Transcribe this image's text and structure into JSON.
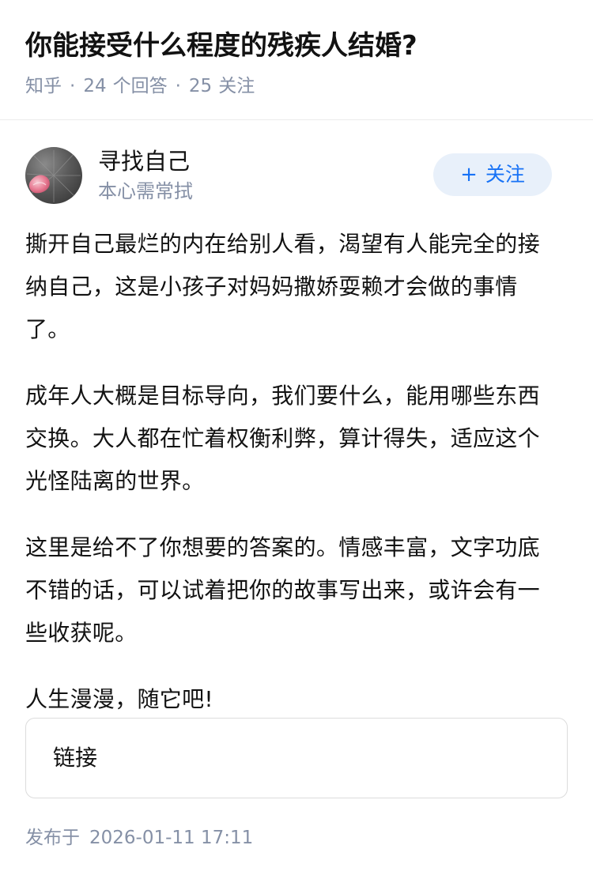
{
  "question": {
    "title": "你能接受什么程度的残疾人结婚?",
    "source": "知乎",
    "separator": "·",
    "answer_count": "24",
    "answer_label": "个回答",
    "follower_count": "25",
    "follower_label": "关注"
  },
  "author": {
    "name": "寻找自己",
    "bio": "本心需常拭",
    "follow_plus": "+",
    "follow_label": "关注"
  },
  "answer": {
    "paragraphs": [
      "撕开自己最烂的内在给别人看，渴望有人能完全的接纳自己，这是小孩子对妈妈撒娇耍赖才会做的事情了。",
      "成年人大概是目标导向，我们要什么，能用哪些东西交换。大人都在忙着权衡利弊，算计得失，适应这个光怪陆离的世界。",
      "这里是给不了你想要的答案的。情感丰富，文字功底不错的话，可以试着把你的故事写出来，或许会有一些收获呢。",
      "人生漫漫，随它吧!"
    ]
  },
  "link_card": {
    "label": "链接"
  },
  "publish": {
    "label": "发布于",
    "time": "2026-01-11 17:11"
  },
  "colors": {
    "meta_gray": "#8590a6",
    "follow_blue": "#1772f6",
    "follow_bg": "#e8f0fa",
    "text": "#121212"
  }
}
